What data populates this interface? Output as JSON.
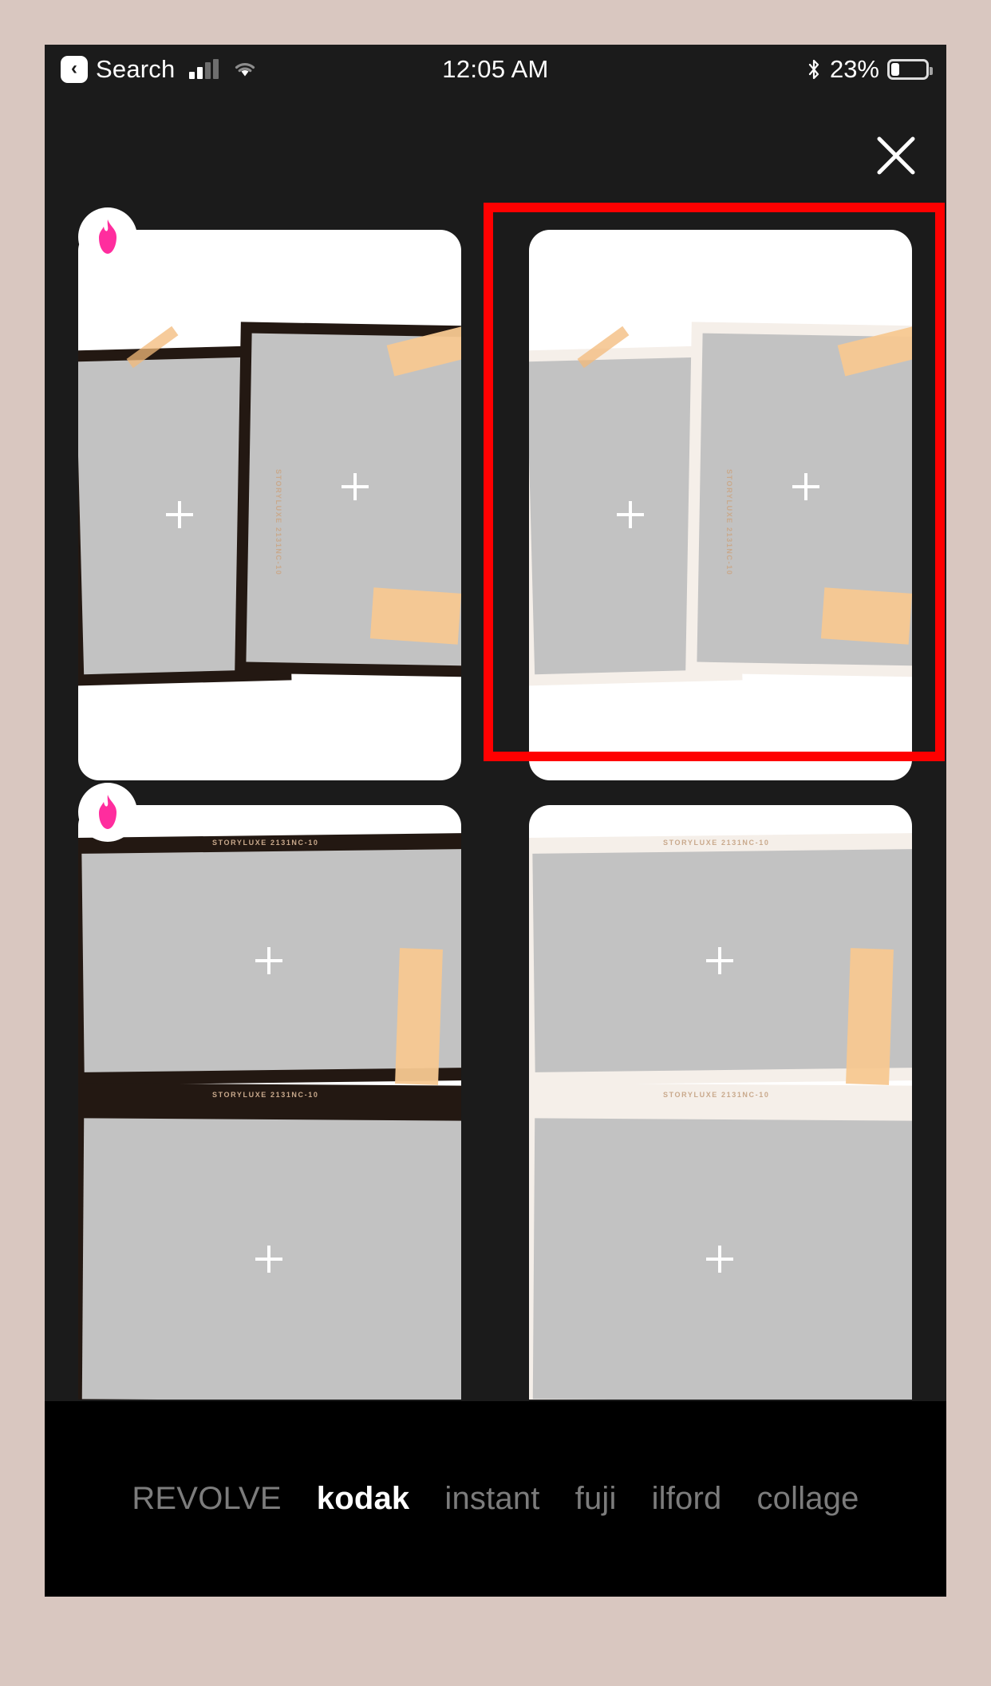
{
  "status_bar": {
    "back_label": "Search",
    "back_icon": "chevron-left-icon",
    "signal_icon": "cellular-signal-icon",
    "wifi_icon": "wifi-icon",
    "time": "12:05 AM",
    "bluetooth_icon": "bluetooth-icon",
    "battery_percent": "23%",
    "battery_icon": "battery-icon"
  },
  "header": {
    "close_icon": "close-icon",
    "close_label": "Close"
  },
  "colors": {
    "selection_red": "#ff0000",
    "flame_pink": "#ff2d9e",
    "app_background": "#1b1b1b",
    "filter_bar_background": "#000000",
    "photo_placeholder": "#c2c2c2"
  },
  "grid": {
    "templates": [
      {
        "id": "kodak-double-dark",
        "name": "double-frame-dark",
        "premium": true,
        "premium_icon": "flame-icon",
        "selected": false,
        "film_label": "STORYLUXE 2131NC-10",
        "photo_slots": 2,
        "slot_icon": "plus-icon"
      },
      {
        "id": "kodak-double-light",
        "name": "double-frame-light",
        "premium": false,
        "selected": true,
        "film_label": "STORYLUXE 2131NC-10",
        "photo_slots": 2,
        "slot_icon": "plus-icon"
      },
      {
        "id": "kodak-stacked-dark",
        "name": "stacked-frame-dark",
        "premium": true,
        "premium_icon": "flame-icon",
        "selected": false,
        "film_label": "STORYLUXE 2131NC-10",
        "photo_slots": 2,
        "slot_icon": "plus-icon"
      },
      {
        "id": "kodak-stacked-light",
        "name": "stacked-frame-light",
        "premium": false,
        "selected": false,
        "film_label": "STORYLUXE 2131NC-10",
        "photo_slots": 2,
        "slot_icon": "plus-icon"
      }
    ]
  },
  "filter_bar": {
    "tabs": [
      {
        "label": "REVOLVE",
        "active": false
      },
      {
        "label": "kodak",
        "active": true
      },
      {
        "label": "instant",
        "active": false
      },
      {
        "label": "fuji",
        "active": false
      },
      {
        "label": "ilford",
        "active": false
      },
      {
        "label": "collage",
        "active": false
      }
    ]
  }
}
